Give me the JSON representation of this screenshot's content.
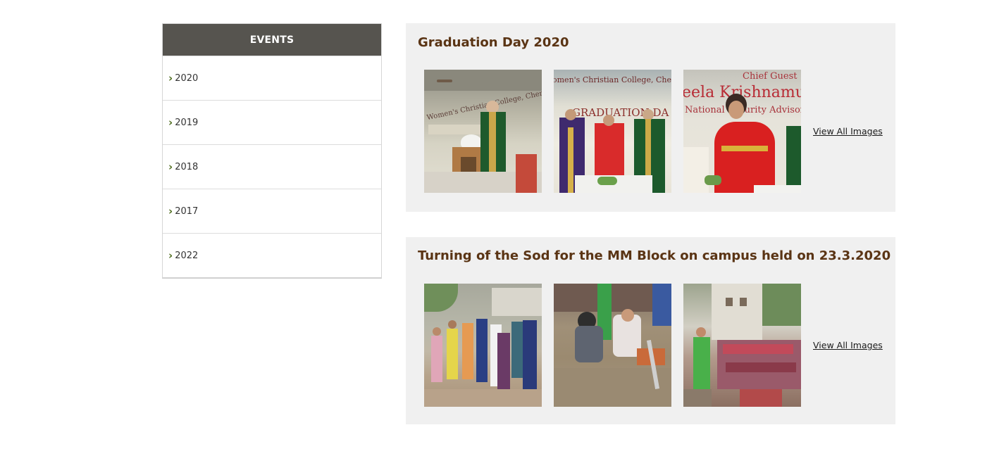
{
  "sidebar": {
    "header": "EVENTS",
    "items": [
      {
        "label": "2020"
      },
      {
        "label": "2019"
      },
      {
        "label": "2018"
      },
      {
        "label": "2017"
      },
      {
        "label": "2022"
      }
    ]
  },
  "events": [
    {
      "title": "Graduation Day 2020",
      "view_all": "View All Images"
    },
    {
      "title": "Turning of the Sod for the MM Block on campus held on 23.3.2020",
      "view_all": "View All Images"
    }
  ],
  "colors": {
    "sidebar_header_bg": "#56544f",
    "chevron": "#4f6d1e",
    "event_title": "#5a3414",
    "panel_bg": "#f0f0f0"
  },
  "icons": {
    "sidebar_item": "chevron-right-icon"
  }
}
